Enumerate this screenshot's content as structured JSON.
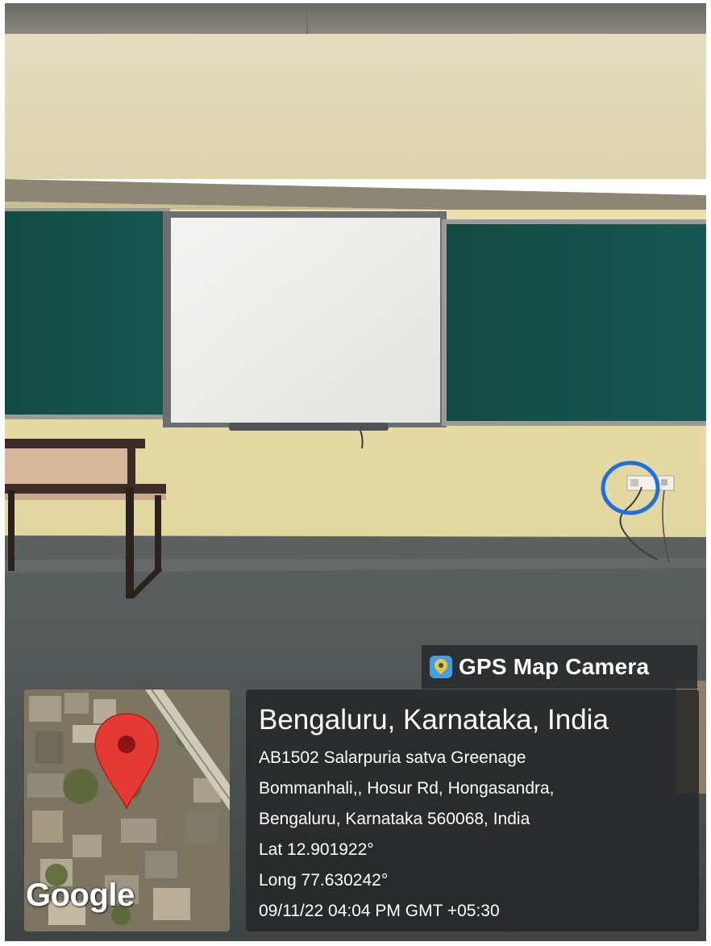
{
  "overlay": {
    "app_name": "GPS Map Camera",
    "app_icon": "gps-map-camera-app-icon",
    "map_attribution": "Google",
    "location_title": "Bengaluru, Karnataka, India",
    "address_lines": [
      "AB1502 Salarpuria satva Greenage",
      "Bommanhali,, Hosur Rd, Hongasandra,",
      "Bengaluru, Karnataka 560068, India"
    ],
    "latitude": "Lat 12.901922°",
    "longitude": "Long 77.630242°",
    "timestamp": "09/11/22 04:04 PM GMT +05:30"
  },
  "colors": {
    "wall": "#e7dca8",
    "greenboard": "#134f48",
    "whiteboard": "#eeeeec",
    "floor": "#4a4f4f",
    "marker_circle": "#1f6fe0",
    "map_pin": "#e53935",
    "overlay_panel": "#262829"
  }
}
